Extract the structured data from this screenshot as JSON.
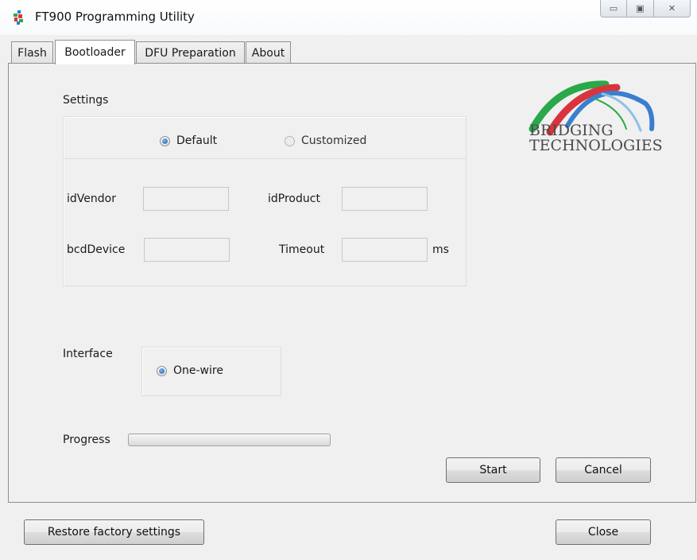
{
  "window": {
    "title": "FT900 Programming Utility",
    "minimize_glyph": "▭",
    "maximize_glyph": "▣",
    "close_glyph": "✕"
  },
  "tabs": [
    {
      "label": "Flash",
      "active": false
    },
    {
      "label": "Bootloader",
      "active": true
    },
    {
      "label": "DFU Preparation",
      "active": false
    },
    {
      "label": "About",
      "active": false
    }
  ],
  "settings": {
    "label": "Settings",
    "mode_options": [
      {
        "label": "Default",
        "checked": true
      },
      {
        "label": "Customized",
        "checked": false
      }
    ],
    "fields": {
      "id_vendor": {
        "label": "idVendor",
        "value": ""
      },
      "id_product": {
        "label": "idProduct",
        "value": ""
      },
      "bcd_device": {
        "label": "bcdDevice",
        "value": ""
      },
      "timeout": {
        "label": "Timeout",
        "value": "",
        "unit": "ms"
      }
    }
  },
  "interface": {
    "label": "Interface",
    "options": [
      {
        "label": "One-wire",
        "checked": true
      }
    ]
  },
  "progress": {
    "label": "Progress",
    "value": 0
  },
  "buttons": {
    "start": "Start",
    "cancel": "Cancel",
    "restore": "Restore factory settings",
    "close": "Close"
  },
  "logo": {
    "line1": "BRIDGING",
    "line2": "TECHNOLOGIES",
    "colors": [
      "#2aa84a",
      "#d9343c",
      "#3a7fcf",
      "#8fc0e8"
    ]
  },
  "colors": {
    "accent_radio": "#1f5fb2",
    "window_bg": "#f0f0f0"
  }
}
